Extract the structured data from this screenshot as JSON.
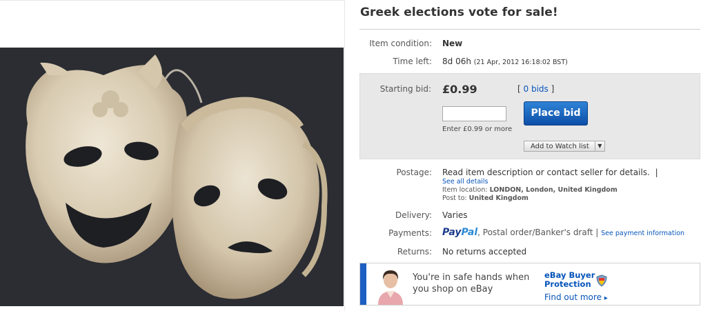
{
  "listing": {
    "title": "Greek elections vote for sale!"
  },
  "details": {
    "condition_label": "Item condition:",
    "condition_value": "New",
    "time_label": "Time left:",
    "time_value": "8d 06h",
    "time_end": "(21 Apr, 2012 16:18:02 BST)"
  },
  "bidding": {
    "starting_label": "Starting bid:",
    "price": "£0.99",
    "bids_open": "[",
    "bids_link": "0 bids",
    "bids_close": "]",
    "input_value": "",
    "place_bid_label": "Place bid",
    "enter_hint": "Enter £0.99 or more",
    "watch_label": "Add to Watch list",
    "watch_arrow": "▼"
  },
  "postage": {
    "label": "Postage:",
    "value": "Read item description or contact seller for details.",
    "separator": "|",
    "see_all": "See all details",
    "location_label": "Item location:",
    "location_value": "LONDON, London, United Kingdom",
    "post_to_label": "Post to:",
    "post_to_value": "United Kingdom"
  },
  "delivery": {
    "label": "Delivery:",
    "value": "Varies"
  },
  "payments": {
    "label": "Payments:",
    "paypal_a": "Pay",
    "paypal_b": "Pal",
    "other": ", Postal order/Banker's draft",
    "separator": "|",
    "link": "See payment information"
  },
  "returns": {
    "label": "Returns:",
    "value": "No returns accepted"
  },
  "protection_banner": {
    "line1": "You're in safe hands when",
    "line2": "you shop on eBay",
    "title_line1": "eBay Buyer",
    "title_line2": "Protection",
    "find_more": "Find out more",
    "find_more_arrow": "▸"
  },
  "colors": {
    "link_blue": "#0654ba",
    "button_blue": "#1f6cc4",
    "bid_panel_bg": "#e8e8e8",
    "banner_bar": "#1d5fc2"
  },
  "icons": {
    "shield": "shield-icon",
    "dropdown": "chevron-down-icon"
  }
}
